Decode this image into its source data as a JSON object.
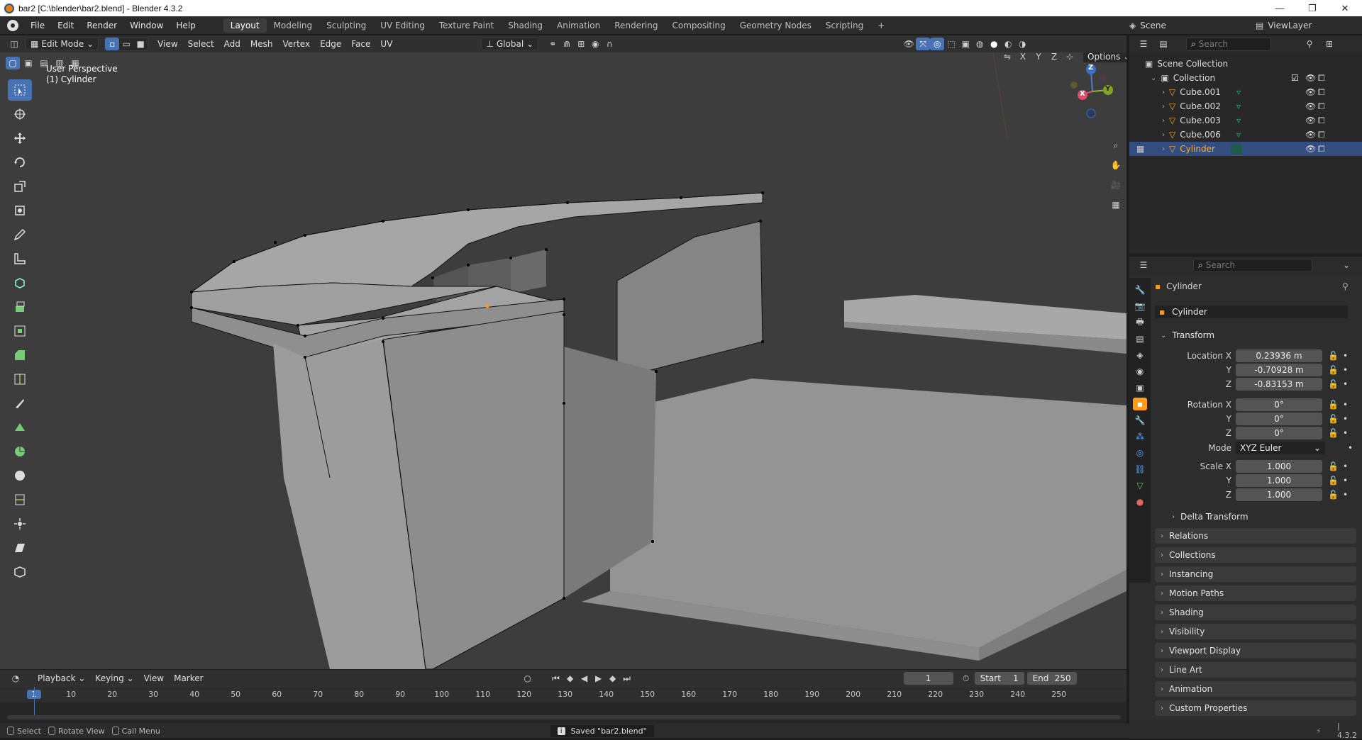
{
  "window": {
    "title": "bar2 [C:\\blender\\bar2.blend] - Blender 4.3.2",
    "minimize": "—",
    "maximize": "❐",
    "close": "✕"
  },
  "menu": [
    "File",
    "Edit",
    "Render",
    "Window",
    "Help"
  ],
  "workspaces": [
    "Layout",
    "Modeling",
    "Sculpting",
    "UV Editing",
    "Texture Paint",
    "Shading",
    "Animation",
    "Rendering",
    "Compositing",
    "Geometry Nodes",
    "Scripting"
  ],
  "active_workspace": "Layout",
  "scene": {
    "label": "Scene",
    "viewlayer": "ViewLayer"
  },
  "viewport_header": {
    "mode": "Edit Mode",
    "menus": [
      "View",
      "Select",
      "Add",
      "Mesh",
      "Vertex",
      "Edge",
      "Face",
      "UV"
    ],
    "orientation": "Global",
    "options": "Options",
    "axes": [
      "X",
      "Y",
      "Z"
    ]
  },
  "viewport": {
    "perspective": "User Perspective",
    "object": "(1) Cylinder",
    "gizmo": {
      "x": "X",
      "y": "Y",
      "z": "Z"
    }
  },
  "outliner": {
    "search_placeholder": "Search",
    "root": "Scene Collection",
    "collection": "Collection",
    "items": [
      "Cube.001",
      "Cube.002",
      "Cube.003",
      "Cube.006",
      "Cylinder"
    ],
    "selected": "Cylinder"
  },
  "properties": {
    "search_placeholder": "Search",
    "object_name": "Cylinder",
    "datablock": "Cylinder",
    "transform_label": "Transform",
    "location": {
      "label": "Location X",
      "x": "0.23936 m",
      "y": "-0.70928 m",
      "z": "-0.83153 m"
    },
    "rotation": {
      "label": "Rotation X",
      "x": "0°",
      "y": "0°",
      "z": "0°"
    },
    "mode": {
      "label": "Mode",
      "value": "XYZ Euler"
    },
    "scale": {
      "label": "Scale X",
      "x": "1.000",
      "y": "1.000",
      "z": "1.000"
    },
    "axis_y": "Y",
    "axis_z": "Z",
    "delta": "Delta Transform",
    "panels": [
      "Relations",
      "Collections",
      "Instancing",
      "Motion Paths",
      "Shading",
      "Visibility",
      "Viewport Display",
      "Line Art",
      "Animation",
      "Custom Properties"
    ]
  },
  "timeline": {
    "menus": [
      "Playback",
      "Keying",
      "View",
      "Marker"
    ],
    "current_frame": "1",
    "start_label": "Start",
    "start": "1",
    "end_label": "End",
    "end": "250",
    "ticks": [
      "1",
      "10",
      "20",
      "30",
      "40",
      "50",
      "60",
      "70",
      "80",
      "90",
      "100",
      "110",
      "120",
      "130",
      "140",
      "150",
      "160",
      "170",
      "180",
      "190",
      "200",
      "210",
      "220",
      "230",
      "240",
      "250"
    ]
  },
  "status": {
    "select": "Select",
    "rotate": "Rotate View",
    "call_menu": "Call Menu",
    "message": "Saved \"bar2.blend\"",
    "version": "4.3.2"
  },
  "colors": {
    "accent": "#4772b3",
    "selected_text": "#ffaf29",
    "viewport_bg": "#3d3d3d"
  }
}
